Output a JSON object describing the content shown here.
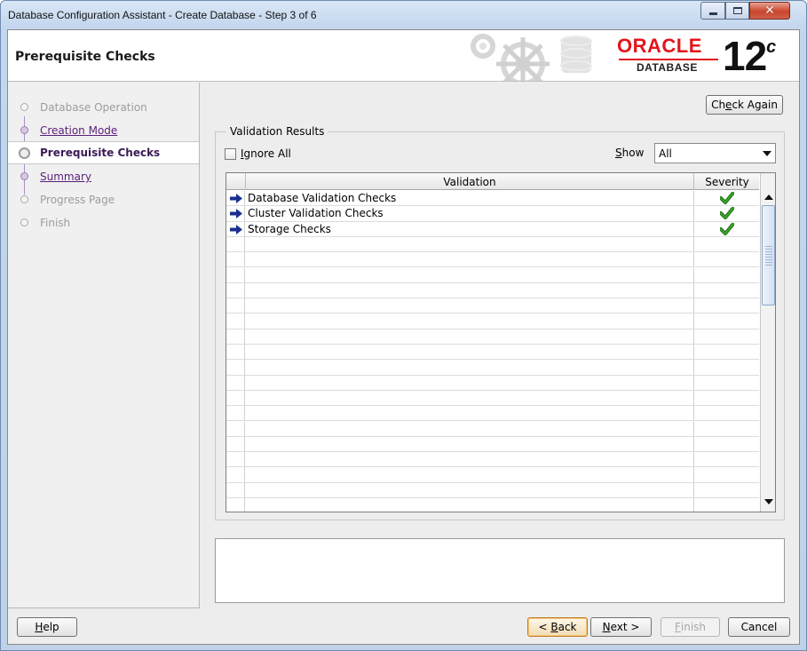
{
  "window": {
    "title": "Database Configuration Assistant - Create Database - Step 3 of 6",
    "controls": [
      "minimize",
      "maximize",
      "close"
    ]
  },
  "header": {
    "title": "Prerequisite Checks",
    "logo": {
      "brand": "ORACLE",
      "product": "DATABASE",
      "version": "12",
      "version_suffix": "c"
    }
  },
  "steps": [
    {
      "label": "Database Operation",
      "state": "disabled"
    },
    {
      "label": "Creation Mode",
      "state": "link"
    },
    {
      "label": "Prerequisite Checks",
      "state": "current"
    },
    {
      "label": "Summary",
      "state": "link"
    },
    {
      "label": "Progress Page",
      "state": "disabled"
    },
    {
      "label": "Finish",
      "state": "disabled"
    }
  ],
  "main": {
    "check_again_pre": "Ch",
    "check_again_mn": "e",
    "check_again_post": "ck Again",
    "results_legend": "Validation Results",
    "ignore_all_mn": "I",
    "ignore_all_rest": "gnore All",
    "ignore_all_checked": false,
    "show_label_mn": "S",
    "show_label_rest": "how",
    "show_value": "All",
    "table": {
      "columns": [
        "Validation",
        "Severity"
      ],
      "rows": [
        {
          "name": "Database Validation Checks",
          "severity": "succeeded"
        },
        {
          "name": "Cluster Validation Checks",
          "severity": "succeeded"
        },
        {
          "name": "Storage Checks",
          "severity": "succeeded"
        }
      ],
      "empty_rows": 18
    },
    "message_text": ""
  },
  "footer": {
    "help_mn": "H",
    "help_rest": "elp",
    "back_pre": "< ",
    "back_mn": "B",
    "back_rest": "ack",
    "next_mn": "N",
    "next_rest": "ext >",
    "finish_mn": "F",
    "finish_rest": "inish",
    "cancel_label": "Cancel"
  },
  "colors": {
    "oracle_red": "#e2161c",
    "check_green": "#3aa02a",
    "row_arrow": "#1a2f8f",
    "step_link": "#5a1e7a"
  }
}
